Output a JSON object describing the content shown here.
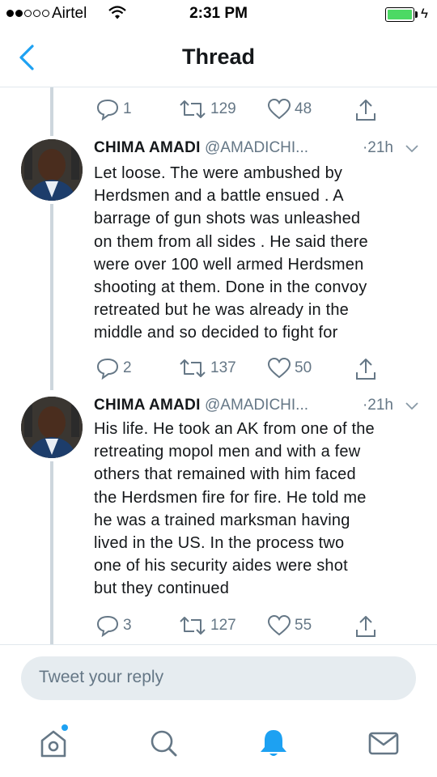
{
  "status_bar": {
    "carrier": "Airtel",
    "time": "2:31 PM",
    "battery_level": 1.0
  },
  "nav": {
    "back_icon": "chevron-left-icon",
    "title": "Thread"
  },
  "top_actions": {
    "replies": "1",
    "retweets": "129",
    "likes": "48"
  },
  "tweets": [
    {
      "author": "CHIMA AMADI",
      "handle": "@AMADICHI...",
      "time": "·21h",
      "text": "Let loose. The were ambushed by\nHerdsmen and a battle ensued . A\nbarrage of gun shots was unleashed\non them from all sides . He said there\nwere over 100 well armed Herdsmen\nshooting at them. Done in the convoy\nretreated but he was already in the\nmiddle and so decided to fight for",
      "replies": "2",
      "retweets": "137",
      "likes": "50"
    },
    {
      "author": "CHIMA AMADI",
      "handle": "@AMADICHI...",
      "time": "·21h",
      "text": "His life. He took an AK from one of the\nretreating mopol men and with a few\nothers that remained with him faced\nthe Herdsmen fire for fire. He told me\nhe was a trained marksman having\nlived in the US. In the process two\none of his security aides were shot\nbut they continued",
      "replies": "3",
      "retweets": "127",
      "likes": "55"
    }
  ],
  "reply": {
    "placeholder": "Tweet your reply"
  },
  "colors": {
    "accent": "#1da1f2",
    "muted": "#657786",
    "text": "#14171a",
    "thread_line": "#cdd6dd"
  }
}
